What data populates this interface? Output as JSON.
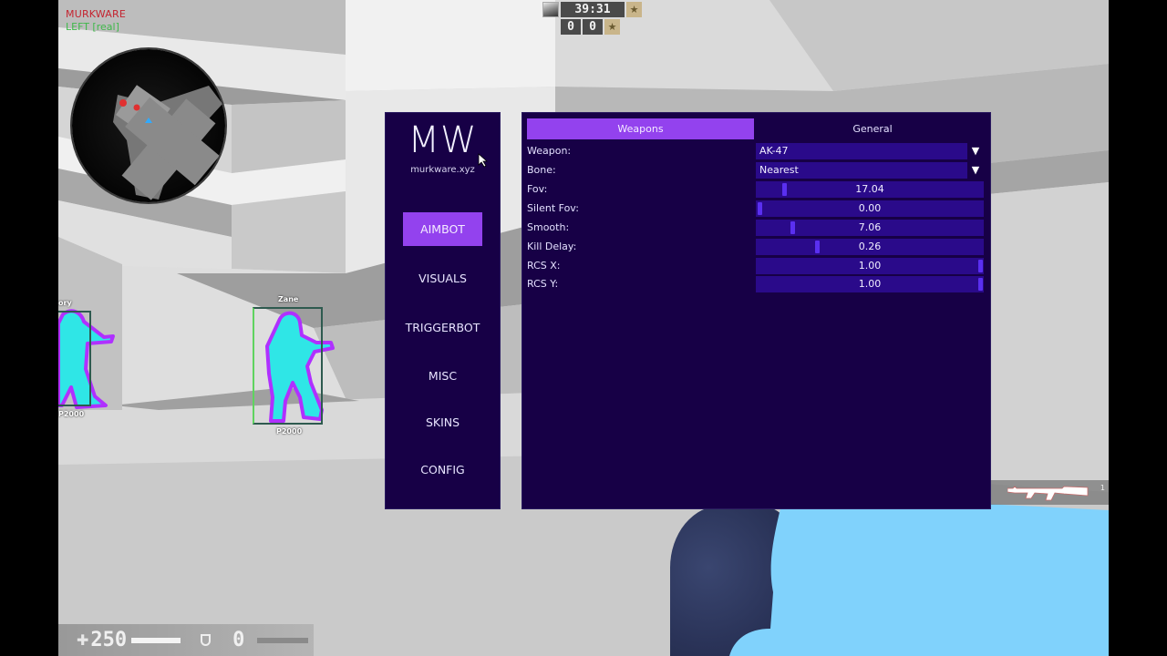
{
  "hud": {
    "brand": "MURKWARE",
    "antiaim_status": "LEFT [real]",
    "round_timer": "39:31",
    "score_ct": "0",
    "score_t": "0",
    "health": "250",
    "health_fraction": 1.0,
    "armor": "0",
    "armor_fraction": 0.0,
    "weapon_slot": "1",
    "health_icon": "plus-icon",
    "armor_icon": "shield-icon"
  },
  "players": [
    {
      "name": "ory",
      "weapon": "P2000"
    },
    {
      "name": "Zane",
      "weapon": "P2000"
    }
  ],
  "menu": {
    "logo": "MW",
    "url": "murkware.xyz",
    "nav": [
      {
        "label": "AIMBOT",
        "active": true
      },
      {
        "label": "VISUALS",
        "active": false
      },
      {
        "label": "TRIGGERBOT",
        "active": false
      },
      {
        "label": "MISC",
        "active": false
      },
      {
        "label": "SKINS",
        "active": false
      },
      {
        "label": "CONFIG",
        "active": false
      }
    ],
    "tabs": [
      {
        "label": "Weapons",
        "active": true
      },
      {
        "label": "General",
        "active": false
      }
    ],
    "fields": {
      "weapon": {
        "label": "Weapon:",
        "value": "AK-47"
      },
      "bone": {
        "label": "Bone:",
        "value": "Nearest"
      },
      "fov": {
        "label": "Fov:",
        "value": "17.04",
        "fraction": 0.11
      },
      "silent_fov": {
        "label": "Silent Fov:",
        "value": "0.00",
        "fraction": 0.0
      },
      "smooth": {
        "label": "Smooth:",
        "value": "7.06",
        "fraction": 0.15
      },
      "kill_delay": {
        "label": "Kill Delay:",
        "value": "0.26",
        "fraction": 0.26
      },
      "rcs_x": {
        "label": "RCS X:",
        "value": "1.00",
        "fraction": 1.0
      },
      "rcs_y": {
        "label": "RCS Y:",
        "value": "1.00",
        "fraction": 1.0
      }
    }
  },
  "colors": {
    "panel_bg": "#170046",
    "accent": "#9342ee",
    "control_bg": "#2a0a8a",
    "slider_grab": "#5a2ff0",
    "brand_red": "#c42430",
    "status_green": "#3fb84a",
    "chams": "#2fe6e6",
    "glow": "#b030ff"
  }
}
